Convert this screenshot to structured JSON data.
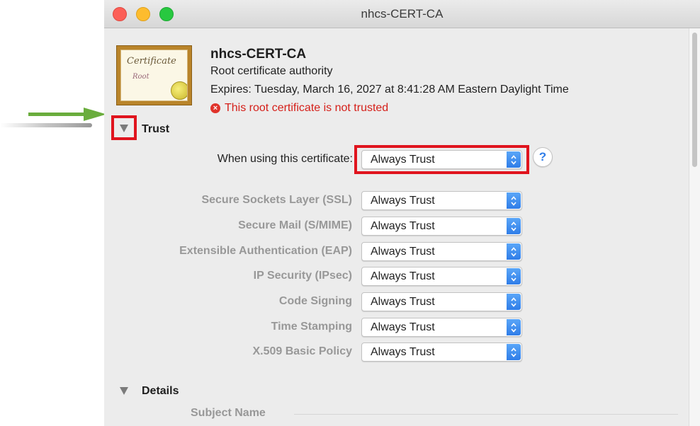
{
  "window": {
    "title": "nhcs-CERT-CA"
  },
  "certificate": {
    "name": "nhcs-CERT-CA",
    "kind": "Root certificate authority",
    "expires": "Expires: Tuesday, March 16, 2027 at 8:41:28 AM Eastern Daylight Time",
    "warning": "This root certificate is not trusted",
    "icon": {
      "script": "Certificate",
      "subscript": "Root"
    }
  },
  "trust": {
    "section_title": "Trust",
    "when_using_label": "When using this certificate:",
    "when_using_value": "Always Trust",
    "help_label": "?",
    "policies": [
      {
        "label": "Secure Sockets Layer (SSL)",
        "value": "Always Trust"
      },
      {
        "label": "Secure Mail (S/MIME)",
        "value": "Always Trust"
      },
      {
        "label": "Extensible Authentication (EAP)",
        "value": "Always Trust"
      },
      {
        "label": "IP Security (IPsec)",
        "value": "Always Trust"
      },
      {
        "label": "Code Signing",
        "value": "Always Trust"
      },
      {
        "label": "Time Stamping",
        "value": "Always Trust"
      },
      {
        "label": "X.509 Basic Policy",
        "value": "Always Trust"
      }
    ]
  },
  "details": {
    "section_title": "Details",
    "subject_name_label": "Subject Name"
  },
  "colors": {
    "highlight": "#e0141e",
    "annotation_arrow": "#6aad3d",
    "warning": "#d5201a",
    "popup_accent": "#2f7de8"
  },
  "icons": {
    "close": "close-icon",
    "minimize": "minimize-icon",
    "zoom": "zoom-icon",
    "warning": "warning-icon",
    "disclosure": "disclosure-triangle-icon",
    "popup": "chevron-updown-icon",
    "annotation": "arrow-right-icon"
  }
}
